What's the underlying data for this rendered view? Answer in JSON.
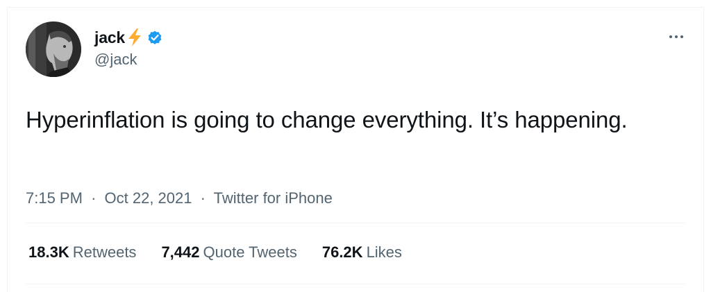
{
  "user": {
    "display_name": "jack",
    "handle": "@jack",
    "emoji_icon": "lightning-bolt-icon",
    "verified_icon": "verified-badge-icon",
    "verified_color": "#1d9bf0",
    "bolt_color": "#ffac33"
  },
  "tweet": {
    "text": "Hyperinflation is going to change everything. It’s happening.",
    "time": "7:15 PM",
    "separator": "·",
    "date": "Oct 22, 2021",
    "source": "Twitter for iPhone"
  },
  "stats": {
    "retweets": {
      "value": "18.3K",
      "label": "Retweets"
    },
    "quote_tweets": {
      "value": "7,442",
      "label": "Quote Tweets"
    },
    "likes": {
      "value": "76.2K",
      "label": "Likes"
    }
  },
  "colors": {
    "text_primary": "#0f1419",
    "text_secondary": "#536471",
    "border": "#eff3f4"
  }
}
